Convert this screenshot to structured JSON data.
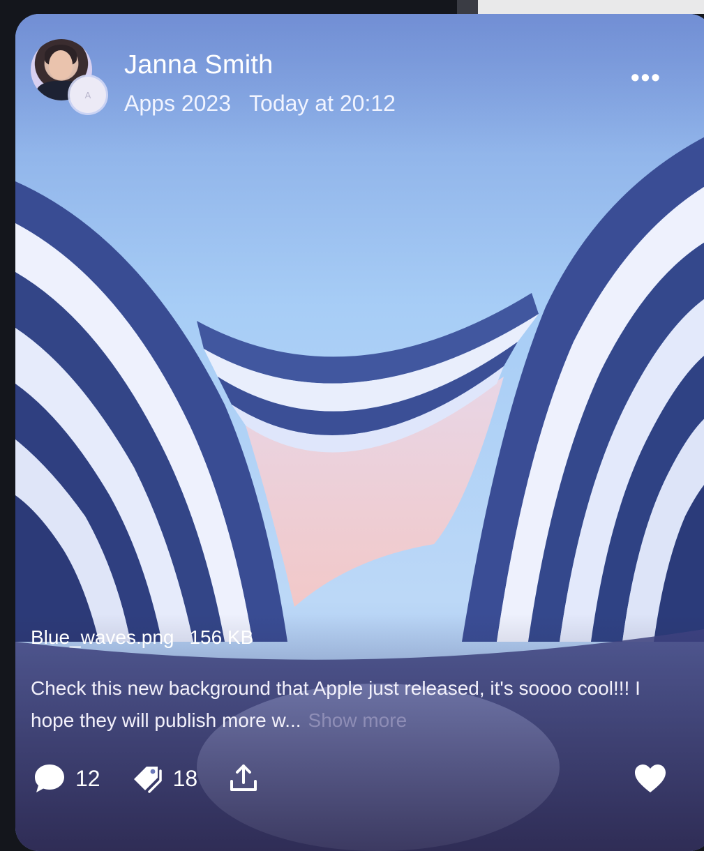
{
  "post": {
    "author": "Janna Smith",
    "badge_letter": "A",
    "channel": "Apps 2023",
    "time": "Today at 20:12",
    "menu_glyph": "•••",
    "file_name": "Blue_waves.png",
    "file_size": "156 KB",
    "text": "Check this new background that Apple just released, it's soooo cool!!! I hope they will publish more w...",
    "show_more": "Show more",
    "comments": "12",
    "tags": "18"
  },
  "icons": {
    "comment": "speech-bubble-icon",
    "tag": "tag-icon",
    "share": "share-upload-icon",
    "like": "heart-icon",
    "menu": "more-dots-icon"
  },
  "colors": {
    "text": "#ffffff",
    "background": "#14161c"
  }
}
